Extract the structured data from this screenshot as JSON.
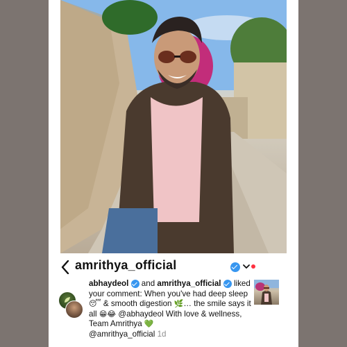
{
  "header": {
    "username": "amrithya_official",
    "verified": true,
    "has_dropdown": true,
    "new_indicator_color": "#ff3040"
  },
  "notification": {
    "actor": "abhaydeol",
    "joiner": " and ",
    "second_actor": "amrithya_official",
    "action": " liked your comment: ",
    "comment_part1": "When you've had deep sleep ",
    "emoji_sleep": "😴",
    "comment_part2": " & smooth digestion ",
    "emoji_leaf": "🌿",
    "comment_part3": "… the smile says it all ",
    "emoji_grin": "😁",
    "emoji_laugh": "😂",
    "mention_1": " @abhaydeol",
    "comment_part4": " With love & wellness, Team Amrithya ",
    "emoji_heart": "💚",
    "mention_2": "@amrithya_official",
    "time": "1d"
  },
  "colors": {
    "verified_blue": "#3897f0",
    "background": "#7c7470",
    "timestamp_gray": "#8e8e8e"
  },
  "icons": [
    "back-chevron-icon",
    "verified-badge-icon",
    "chevron-down-icon"
  ]
}
